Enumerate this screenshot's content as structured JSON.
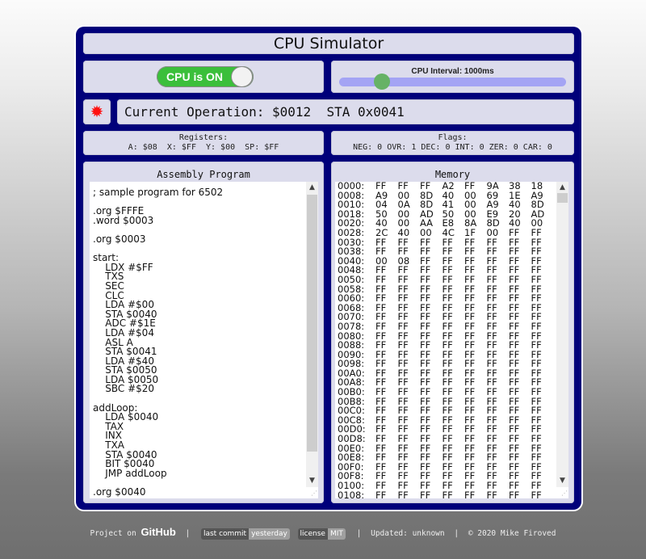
{
  "app": {
    "title": "CPU Simulator"
  },
  "power": {
    "label": "CPU is ON",
    "on": true
  },
  "interval": {
    "label": "CPU Interval: 1000ms",
    "value_ms": 1000,
    "slider_fraction": 0.19,
    "accent": "#66b266"
  },
  "status": {
    "led_icon": "red-light-icon",
    "current_operation": "Current Operation: $0012  STA 0x0041"
  },
  "registers": {
    "title": "Registers:",
    "values": "A: $08  X: $FF  Y: $00  SP: $FF"
  },
  "flags": {
    "title": "Flags:",
    "values": "NEG: 0 OVR: 1 DEC: 0 INT: 0 ZER: 0 CAR: 0"
  },
  "assembly": {
    "title": "Assembly Program",
    "code": "; sample program for 6502\n\n.org $FFFE\n.word $0003\n\n.org $0003\n\nstart:\n    LDX #$FF\n    TXS\n    SEC\n    CLC\n    LDA #$00\n    STA $0040\n    ADC #$1E\n    LDA #$04\n    ASL A\n    STA $0041\n    LDA #$40\n    STA $0050\n    LDA $0050\n    SBC #$20\n\naddLoop:\n    LDA $0040\n    TAX\n    INX\n    TXA\n    STA $0040\n    BIT $0040\n    JMP addLoop\n\n.org $0040"
  },
  "memory": {
    "title": "Memory",
    "rows": [
      {
        "addr": "0000:",
        "bytes": [
          "FF",
          "FF",
          "FF",
          "A2",
          "FF",
          "9A",
          "38",
          "18"
        ]
      },
      {
        "addr": "0008:",
        "bytes": [
          "A9",
          "00",
          "8D",
          "40",
          "00",
          "69",
          "1E",
          "A9"
        ]
      },
      {
        "addr": "0010:",
        "bytes": [
          "04",
          "0A",
          "8D",
          "41",
          "00",
          "A9",
          "40",
          "8D"
        ]
      },
      {
        "addr": "0018:",
        "bytes": [
          "50",
          "00",
          "AD",
          "50",
          "00",
          "E9",
          "20",
          "AD"
        ]
      },
      {
        "addr": "0020:",
        "bytes": [
          "40",
          "00",
          "AA",
          "E8",
          "8A",
          "8D",
          "40",
          "00"
        ]
      },
      {
        "addr": "0028:",
        "bytes": [
          "2C",
          "40",
          "00",
          "4C",
          "1F",
          "00",
          "FF",
          "FF"
        ]
      },
      {
        "addr": "0030:",
        "bytes": [
          "FF",
          "FF",
          "FF",
          "FF",
          "FF",
          "FF",
          "FF",
          "FF"
        ]
      },
      {
        "addr": "0038:",
        "bytes": [
          "FF",
          "FF",
          "FF",
          "FF",
          "FF",
          "FF",
          "FF",
          "FF"
        ]
      },
      {
        "addr": "0040:",
        "bytes": [
          "00",
          "08",
          "FF",
          "FF",
          "FF",
          "FF",
          "FF",
          "FF"
        ]
      },
      {
        "addr": "0048:",
        "bytes": [
          "FF",
          "FF",
          "FF",
          "FF",
          "FF",
          "FF",
          "FF",
          "FF"
        ]
      },
      {
        "addr": "0050:",
        "bytes": [
          "FF",
          "FF",
          "FF",
          "FF",
          "FF",
          "FF",
          "FF",
          "FF"
        ]
      },
      {
        "addr": "0058:",
        "bytes": [
          "FF",
          "FF",
          "FF",
          "FF",
          "FF",
          "FF",
          "FF",
          "FF"
        ]
      },
      {
        "addr": "0060:",
        "bytes": [
          "FF",
          "FF",
          "FF",
          "FF",
          "FF",
          "FF",
          "FF",
          "FF"
        ]
      },
      {
        "addr": "0068:",
        "bytes": [
          "FF",
          "FF",
          "FF",
          "FF",
          "FF",
          "FF",
          "FF",
          "FF"
        ]
      },
      {
        "addr": "0070:",
        "bytes": [
          "FF",
          "FF",
          "FF",
          "FF",
          "FF",
          "FF",
          "FF",
          "FF"
        ]
      },
      {
        "addr": "0078:",
        "bytes": [
          "FF",
          "FF",
          "FF",
          "FF",
          "FF",
          "FF",
          "FF",
          "FF"
        ]
      },
      {
        "addr": "0080:",
        "bytes": [
          "FF",
          "FF",
          "FF",
          "FF",
          "FF",
          "FF",
          "FF",
          "FF"
        ]
      },
      {
        "addr": "0088:",
        "bytes": [
          "FF",
          "FF",
          "FF",
          "FF",
          "FF",
          "FF",
          "FF",
          "FF"
        ]
      },
      {
        "addr": "0090:",
        "bytes": [
          "FF",
          "FF",
          "FF",
          "FF",
          "FF",
          "FF",
          "FF",
          "FF"
        ]
      },
      {
        "addr": "0098:",
        "bytes": [
          "FF",
          "FF",
          "FF",
          "FF",
          "FF",
          "FF",
          "FF",
          "FF"
        ]
      },
      {
        "addr": "00A0:",
        "bytes": [
          "FF",
          "FF",
          "FF",
          "FF",
          "FF",
          "FF",
          "FF",
          "FF"
        ]
      },
      {
        "addr": "00A8:",
        "bytes": [
          "FF",
          "FF",
          "FF",
          "FF",
          "FF",
          "FF",
          "FF",
          "FF"
        ]
      },
      {
        "addr": "00B0:",
        "bytes": [
          "FF",
          "FF",
          "FF",
          "FF",
          "FF",
          "FF",
          "FF",
          "FF"
        ]
      },
      {
        "addr": "00B8:",
        "bytes": [
          "FF",
          "FF",
          "FF",
          "FF",
          "FF",
          "FF",
          "FF",
          "FF"
        ]
      },
      {
        "addr": "00C0:",
        "bytes": [
          "FF",
          "FF",
          "FF",
          "FF",
          "FF",
          "FF",
          "FF",
          "FF"
        ]
      },
      {
        "addr": "00C8:",
        "bytes": [
          "FF",
          "FF",
          "FF",
          "FF",
          "FF",
          "FF",
          "FF",
          "FF"
        ]
      },
      {
        "addr": "00D0:",
        "bytes": [
          "FF",
          "FF",
          "FF",
          "FF",
          "FF",
          "FF",
          "FF",
          "FF"
        ]
      },
      {
        "addr": "00D8:",
        "bytes": [
          "FF",
          "FF",
          "FF",
          "FF",
          "FF",
          "FF",
          "FF",
          "FF"
        ]
      },
      {
        "addr": "00E0:",
        "bytes": [
          "FF",
          "FF",
          "FF",
          "FF",
          "FF",
          "FF",
          "FF",
          "FF"
        ]
      },
      {
        "addr": "00E8:",
        "bytes": [
          "FF",
          "FF",
          "FF",
          "FF",
          "FF",
          "FF",
          "FF",
          "FF"
        ]
      },
      {
        "addr": "00F0:",
        "bytes": [
          "FF",
          "FF",
          "FF",
          "FF",
          "FF",
          "FF",
          "FF",
          "FF"
        ]
      },
      {
        "addr": "00F8:",
        "bytes": [
          "FF",
          "FF",
          "FF",
          "FF",
          "FF",
          "FF",
          "FF",
          "FF"
        ]
      },
      {
        "addr": "0100:",
        "bytes": [
          "FF",
          "FF",
          "FF",
          "FF",
          "FF",
          "FF",
          "FF",
          "FF"
        ]
      },
      {
        "addr": "0108:",
        "bytes": [
          "FF",
          "FF",
          "FF",
          "FF",
          "FF",
          "FF",
          "FF",
          "FF"
        ]
      }
    ]
  },
  "footer": {
    "project_prefix": "Project on",
    "github_label": "GitHub",
    "separator": "|",
    "badge_commit_key": "last commit",
    "badge_commit_value": "yesterday",
    "badge_license_key": "license",
    "badge_license_value": "MIT",
    "updated": "Updated: unknown",
    "copyright": "© 2020 Mike Firoved"
  },
  "colors": {
    "frame": "#00007a",
    "panel": "#dcdcec",
    "toggle_on": "#3bbf3b",
    "slider_track": "#a4a4f4",
    "led": "#ff1010"
  }
}
